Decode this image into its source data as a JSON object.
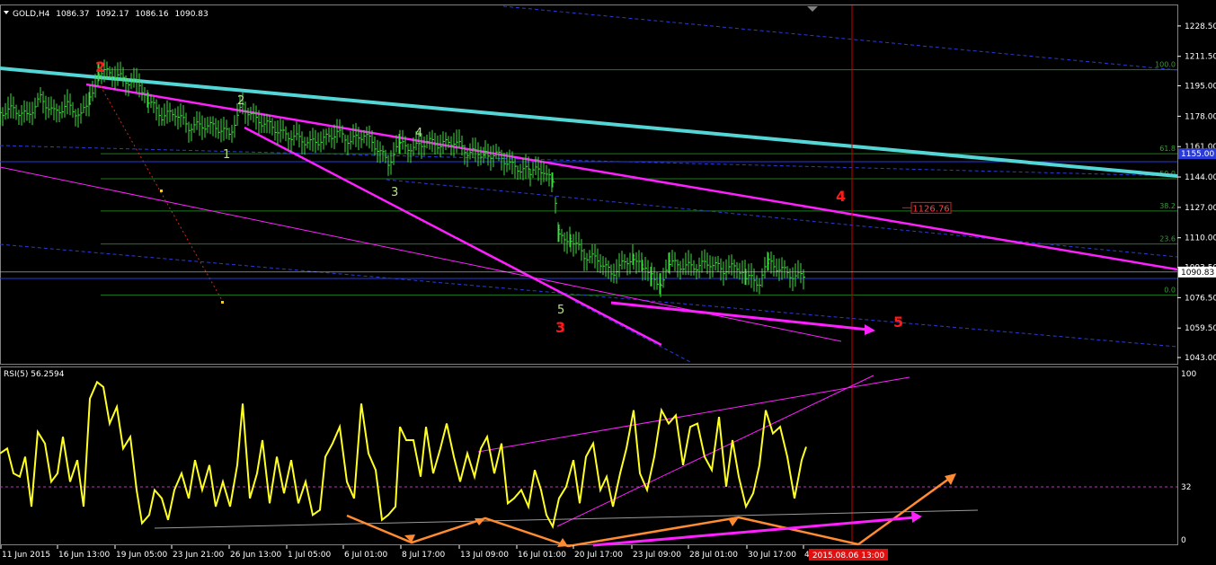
{
  "chart_data": [
    {
      "type": "candlestick",
      "title": "GOLD,H4",
      "ohlc": [
        "1086.37",
        "1092.17",
        "1086.16",
        "1090.83"
      ],
      "ylim": [
        1040,
        1240
      ],
      "yticks": [
        "1228.50",
        "1211.50",
        "1195.00",
        "1178.00",
        "1161.00",
        "1144.00",
        "1127.00",
        "1110.00",
        "1093.50",
        "1076.50",
        "1059.50",
        "1043.00"
      ],
      "current_price": "1090.83",
      "current_price_value": 1090.83,
      "tag_price": "1155.00",
      "target_label": "1126.76",
      "target_value": 1126.76,
      "fibo_levels": [
        {
          "label": "100.0",
          "value": 1204
        },
        {
          "label": "61.8",
          "value": 1157
        },
        {
          "label": "50.0",
          "value": 1143
        },
        {
          "label": "38.2",
          "value": 1125
        },
        {
          "label": "23.6",
          "value": 1106.5
        },
        {
          "label": "0.0",
          "value": 1078
        }
      ],
      "wave_labels_major": [
        "2",
        "3",
        "4",
        "5"
      ],
      "wave_labels_minor": [
        "1",
        "2",
        "3",
        "4",
        "5"
      ],
      "close_path": [
        [
          0,
          1180
        ],
        [
          15,
          1182
        ],
        [
          30,
          1178
        ],
        [
          45,
          1188
        ],
        [
          60,
          1180
        ],
        [
          75,
          1184
        ],
        [
          90,
          1178
        ],
        [
          100,
          1188
        ],
        [
          110,
          1203
        ],
        [
          125,
          1202
        ],
        [
          140,
          1198
        ],
        [
          155,
          1196
        ],
        [
          165,
          1187
        ],
        [
          180,
          1178
        ],
        [
          195,
          1180
        ],
        [
          210,
          1172
        ],
        [
          225,
          1173
        ],
        [
          240,
          1172
        ],
        [
          255,
          1168
        ],
        [
          270,
          1184
        ],
        [
          285,
          1176
        ],
        [
          300,
          1173
        ],
        [
          315,
          1168
        ],
        [
          330,
          1166
        ],
        [
          345,
          1163
        ],
        [
          360,
          1165
        ],
        [
          375,
          1169
        ],
        [
          390,
          1164
        ],
        [
          405,
          1168
        ],
        [
          420,
          1160
        ],
        [
          432,
          1152
        ],
        [
          445,
          1162
        ],
        [
          460,
          1160
        ],
        [
          475,
          1164
        ],
        [
          490,
          1162
        ],
        [
          505,
          1164
        ],
        [
          520,
          1158
        ],
        [
          540,
          1157
        ],
        [
          555,
          1156
        ],
        [
          570,
          1150
        ],
        [
          590,
          1147
        ],
        [
          605,
          1148
        ],
        [
          615,
          1140
        ],
        [
          622,
          1110
        ],
        [
          635,
          1110
        ],
        [
          650,
          1100
        ],
        [
          665,
          1098
        ],
        [
          680,
          1090
        ],
        [
          695,
          1096
        ],
        [
          705,
          1100
        ],
        [
          715,
          1092
        ],
        [
          725,
          1088
        ],
        [
          735,
          1085
        ],
        [
          745,
          1096
        ],
        [
          760,
          1094
        ],
        [
          775,
          1094
        ],
        [
          790,
          1096
        ],
        [
          805,
          1092
        ],
        [
          820,
          1094
        ],
        [
          830,
          1088
        ],
        [
          845,
          1085
        ],
        [
          855,
          1096
        ],
        [
          870,
          1092
        ],
        [
          885,
          1088
        ],
        [
          897,
          1090
        ]
      ]
    },
    {
      "type": "line",
      "title": "RSI(5) 56.2594",
      "ylim": [
        0,
        100
      ],
      "yticks": [
        "100",
        "32",
        "0"
      ],
      "x_ticks": [
        "11 Jun 2015",
        "16 Jun 13:00",
        "19 Jun 05:00",
        "23 Jun 21:00",
        "26 Jun 13:00",
        "1 Jul 05:00",
        "6 Jul 01:00",
        "8 Jul 17:00",
        "13 Jul 09:00",
        "16 Jul 01:00",
        "20 Jul 17:00",
        "23 Jul 09:00",
        "28 Jul 01:00",
        "30 Jul 17:00",
        "4 A"
      ],
      "x_highlight": "2015.08.06 13:00",
      "series": [
        {
          "values": [
            [
              0,
              52
            ],
            [
              8,
              55
            ],
            [
              15,
              40
            ],
            [
              22,
              38
            ],
            [
              28,
              50
            ],
            [
              35,
              20
            ],
            [
              42,
              65
            ],
            [
              50,
              58
            ],
            [
              57,
              35
            ],
            [
              64,
              40
            ],
            [
              70,
              62
            ],
            [
              78,
              35
            ],
            [
              86,
              48
            ],
            [
              93,
              20
            ],
            [
              100,
              85
            ],
            [
              108,
              95
            ],
            [
              115,
              92
            ],
            [
              122,
              70
            ],
            [
              130,
              80
            ],
            [
              137,
              55
            ],
            [
              145,
              62
            ],
            [
              152,
              30
            ],
            [
              158,
              10
            ],
            [
              166,
              15
            ],
            [
              172,
              30
            ],
            [
              180,
              25
            ],
            [
              187,
              12
            ],
            [
              194,
              30
            ],
            [
              202,
              40
            ],
            [
              210,
              25
            ],
            [
              217,
              48
            ],
            [
              225,
              30
            ],
            [
              233,
              45
            ],
            [
              240,
              20
            ],
            [
              248,
              35
            ],
            [
              256,
              20
            ],
            [
              264,
              45
            ],
            [
              270,
              82
            ],
            [
              278,
              25
            ],
            [
              286,
              40
            ],
            [
              292,
              60
            ],
            [
              300,
              22
            ],
            [
              308,
              50
            ],
            [
              316,
              28
            ],
            [
              324,
              48
            ],
            [
              332,
              22
            ],
            [
              340,
              35
            ],
            [
              348,
              15
            ],
            [
              356,
              18
            ],
            [
              362,
              50
            ],
            [
              370,
              58
            ],
            [
              378,
              68
            ],
            [
              386,
              35
            ],
            [
              394,
              25
            ],
            [
              402,
              82
            ],
            [
              410,
              52
            ],
            [
              418,
              42
            ],
            [
              425,
              12
            ],
            [
              432,
              15
            ],
            [
              440,
              20
            ],
            [
              445,
              68
            ],
            [
              452,
              60
            ],
            [
              460,
              60
            ],
            [
              468,
              38
            ],
            [
              474,
              68
            ],
            [
              482,
              40
            ],
            [
              490,
              55
            ],
            [
              497,
              70
            ],
            [
              505,
              50
            ],
            [
              512,
              35
            ],
            [
              520,
              52
            ],
            [
              528,
              38
            ],
            [
              535,
              55
            ],
            [
              542,
              62
            ],
            [
              550,
              40
            ],
            [
              558,
              58
            ],
            [
              565,
              22
            ],
            [
              572,
              25
            ],
            [
              580,
              30
            ],
            [
              588,
              20
            ],
            [
              595,
              42
            ],
            [
              602,
              30
            ],
            [
              608,
              15
            ],
            [
              615,
              8
            ],
            [
              622,
              25
            ],
            [
              630,
              32
            ],
            [
              638,
              48
            ],
            [
              645,
              22
            ],
            [
              652,
              50
            ],
            [
              660,
              58
            ],
            [
              668,
              30
            ],
            [
              675,
              38
            ],
            [
              682,
              20
            ],
            [
              690,
              40
            ],
            [
              697,
              55
            ],
            [
              705,
              78
            ],
            [
              712,
              40
            ],
            [
              720,
              30
            ],
            [
              728,
              50
            ],
            [
              736,
              78
            ],
            [
              744,
              70
            ],
            [
              752,
              75
            ],
            [
              760,
              45
            ],
            [
              768,
              68
            ],
            [
              776,
              70
            ],
            [
              784,
              50
            ],
            [
              792,
              42
            ],
            [
              800,
              74
            ],
            [
              808,
              32
            ],
            [
              815,
              60
            ],
            [
              822,
              38
            ],
            [
              830,
              20
            ],
            [
              838,
              28
            ],
            [
              845,
              45
            ],
            [
              852,
              78
            ],
            [
              860,
              64
            ],
            [
              868,
              68
            ],
            [
              876,
              50
            ],
            [
              884,
              25
            ],
            [
              892,
              48
            ],
            [
              897,
              56
            ]
          ]
        }
      ]
    }
  ]
}
